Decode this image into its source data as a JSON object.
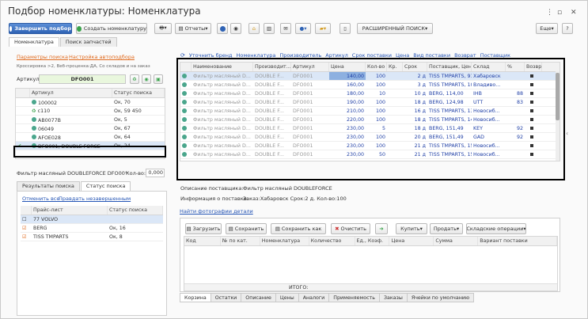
{
  "window": {
    "title": "Подбор номенклатуры: Номенклатура"
  },
  "toolbar": {
    "finish_label": "Завершить подбор",
    "create_label": "Создать номенклатуру",
    "reports_label": "Отчеты",
    "advanced_search_label": "РАСШИРЕННЫЙ ПОИСК",
    "more_label": "Еще",
    "help_label": "?"
  },
  "main_tabs": [
    {
      "label": "Номенклатура"
    },
    {
      "label": "Поиск запчастей"
    }
  ],
  "left": {
    "params_link": "Параметры поиска",
    "autoselect_link": "Настройка автоподбора",
    "crossref_note": "Кроссировка >2, Веб-проценка:ДА, Со складов и на заказ",
    "article_label": "Артикул:",
    "article_value": "DFO001",
    "table_headers": {
      "article": "Артикул",
      "status": "Статус поиска"
    },
    "rows": [
      {
        "article": "100002",
        "status": "Ок, 70",
        "icon": "dot-icon"
      },
      {
        "article": "c110",
        "status": "Ок, 59 450",
        "icon": "recycle-icon"
      },
      {
        "article": "AB0077B",
        "status": "Ок, 5",
        "icon": "dot-icon"
      },
      {
        "article": "06049",
        "status": "Ок, 67",
        "icon": "dot-icon"
      },
      {
        "article": "AFOE028",
        "status": "Ок, 64",
        "icon": "dot-icon"
      },
      {
        "article": "DFO001, DOUBLE FORCE",
        "status": "Ок, 24",
        "icon": "dot-icon"
      }
    ],
    "filter_label": "Фильтр масляный DOUBLEFORCE DFO00°",
    "qty_label": "Кол-во:",
    "qty_value": "0,000",
    "sub_tabs": [
      {
        "label": "Результаты поиска"
      },
      {
        "label": "Статус поиска"
      }
    ],
    "cancel_all": "Отменить все",
    "rerun_link": "Правдать незавершенным",
    "price_headers": {
      "price": "Прайс-лист",
      "status": "Статус поиска"
    },
    "price_rows": [
      {
        "name": "77 VOLVO",
        "status": "",
        "checked": false
      },
      {
        "name": "BERG",
        "status": "Ок, 16",
        "checked": true
      },
      {
        "name": "TISS TMPARTS",
        "status": "Ок, 8",
        "checked": true
      }
    ]
  },
  "right": {
    "links": [
      "Уточнить бренд",
      "Номенклатура",
      "Производитель",
      "Артикул",
      "Срок поставки",
      "Цена",
      "Вид поставки",
      "Возврат",
      "Поставщик"
    ],
    "headers": {
      "name": "Наименование",
      "maker": "Производит...",
      "article": "Артикул",
      "price": "Цена",
      "qty": "Кол-во",
      "kr": "Кр.",
      "term": "Срок",
      "supplier": "Поставщик, Цена",
      "warehouse": "Склад",
      "pct": "%",
      "ret": "Возвр"
    },
    "rows": [
      {
        "name": "Фильтр масляный D...",
        "maker": "DOUBLE F...",
        "article": "DFO001",
        "price": "140,00",
        "qty": "100",
        "term": "2 д",
        "supplier": "TISS TMPARTS, 91,14",
        "warehouse": "Хабаровск",
        "pct": ""
      },
      {
        "name": "Фильтр масляный D...",
        "maker": "DOUBLE F...",
        "article": "DFO001",
        "price": "160,00",
        "qty": "100",
        "term": "3 д",
        "supplier": "TISS TMPARTS, 100...",
        "warehouse": "Владиво...",
        "pct": ""
      },
      {
        "name": "Фильтр масляный D...",
        "maker": "DOUBLE F...",
        "article": "DFO001",
        "price": "180,00",
        "qty": "10",
        "term": "10 д",
        "supplier": "BERG, 114,00",
        "warehouse": "IHB",
        "pct": "88"
      },
      {
        "name": "Фильтр масляный D...",
        "maker": "DOUBLE F...",
        "article": "DFO001",
        "price": "190,00",
        "qty": "100",
        "term": "18 д",
        "supplier": "BERG, 124,98",
        "warehouse": "UTT",
        "pct": "83"
      },
      {
        "name": "Фильтр масляный D...",
        "maker": "DOUBLE F...",
        "article": "DFO001",
        "price": "210,00",
        "qty": "100",
        "term": "16 д",
        "supplier": "TISS TMPARTS, 137...",
        "warehouse": "Новосиб...",
        "pct": ""
      },
      {
        "name": "Фильтр масляный D...",
        "maker": "DOUBLE F...",
        "article": "DFO001",
        "price": "220,00",
        "qty": "100",
        "term": "18 д",
        "supplier": "TISS TMPARTS, 146...",
        "warehouse": "Новосиб...",
        "pct": ""
      },
      {
        "name": "Фильтр масляный D...",
        "maker": "DOUBLE F...",
        "article": "DFO001",
        "price": "230,00",
        "qty": "5",
        "term": "18 д",
        "supplier": "BERG, 151,49",
        "warehouse": "KEY",
        "pct": "92"
      },
      {
        "name": "Фильтр масляный D...",
        "maker": "DOUBLE F...",
        "article": "DFO001",
        "price": "230,00",
        "qty": "100",
        "term": "20 д",
        "supplier": "BERG, 151,49",
        "warehouse": "GAD",
        "pct": "92"
      },
      {
        "name": "Фильтр масляный D...",
        "maker": "DOUBLE F...",
        "article": "DFO001",
        "price": "230,00",
        "qty": "100",
        "term": "21 д",
        "supplier": "TISS TMPARTS, 151...",
        "warehouse": "Новосиб...",
        "pct": ""
      },
      {
        "name": "Фильтр масляный D...",
        "maker": "DOUBLE F...",
        "article": "DFO001",
        "price": "230,00",
        "qty": "50",
        "term": "21 д",
        "supplier": "TISS TMPARTS, 151...",
        "warehouse": "Новосиб...",
        "pct": ""
      }
    ],
    "supplier_desc_label": "Описание поставщика:",
    "supplier_desc_value": "Фильтр масляный DOUBLEFORCE",
    "delivery_label": "Информация о поставке:",
    "delivery_value": "Заказ:Хабаровск Срок:2 д. Кол-во:100",
    "photos_link": "Найти фотографии детали"
  },
  "cart": {
    "load_label": "Загрузить",
    "save_label": "Сохранить",
    "save_as_label": "Сохранить как",
    "clear_label": "Очистить",
    "buy_label": "Купить",
    "sell_label": "Продать",
    "warehouse_ops_label": "Складские операции",
    "headers": [
      "Код",
      "№ по кат.",
      "Номенклатура",
      "Количество",
      "Ед., Коэф.",
      "Цена",
      "Сумма",
      "Вариант поставки"
    ],
    "total_label": "ИТОГО:"
  },
  "bottom_tabs": [
    {
      "label": "Корзина"
    },
    {
      "label": "Остатки"
    },
    {
      "label": "Описание"
    },
    {
      "label": "Цены"
    },
    {
      "label": "Аналоги"
    },
    {
      "label": "Применяемость"
    },
    {
      "label": "Заказы"
    },
    {
      "label": "Ячейки по умолчанию"
    }
  ]
}
